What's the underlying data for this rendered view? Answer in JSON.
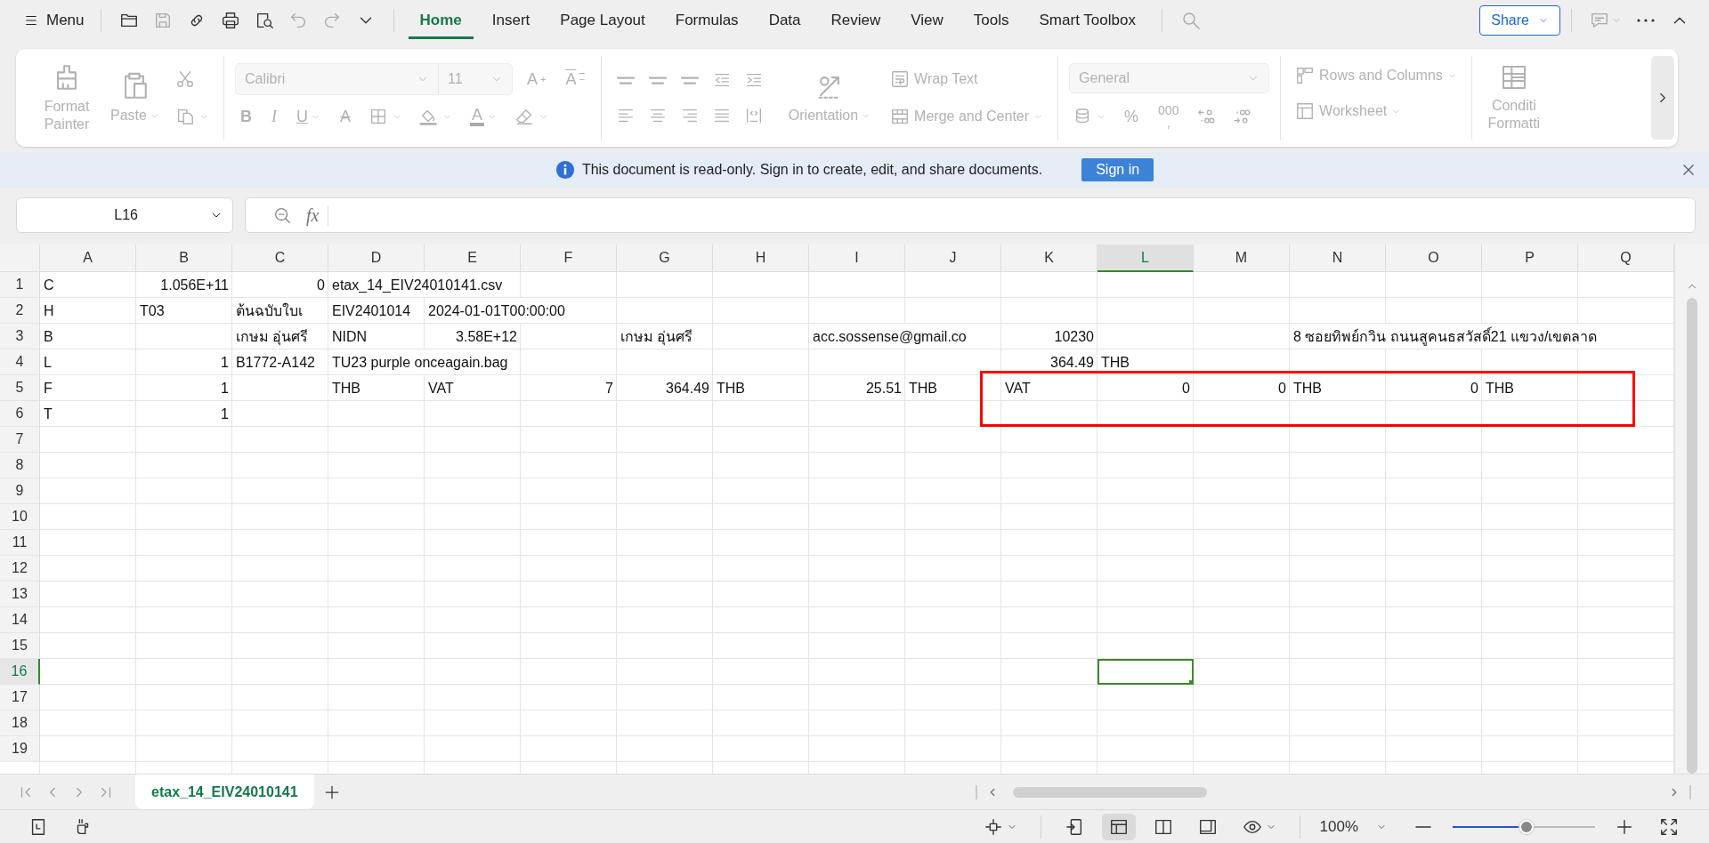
{
  "menu_bar": {
    "menu_label": "Menu",
    "tabs": [
      {
        "label": "Home",
        "selected": true
      },
      {
        "label": "Insert",
        "selected": false
      },
      {
        "label": "Page Layout",
        "selected": false
      },
      {
        "label": "Formulas",
        "selected": false
      },
      {
        "label": "Data",
        "selected": false
      },
      {
        "label": "Review",
        "selected": false
      },
      {
        "label": "View",
        "selected": false
      },
      {
        "label": "Tools",
        "selected": false
      },
      {
        "label": "Smart Toolbox",
        "selected": false
      }
    ],
    "share_label": "Share"
  },
  "ribbon": {
    "disabled": true,
    "format_painter": "Format Painter",
    "paste": "Paste",
    "font_name": "Calibri",
    "font_size": "11",
    "grow_font": "A$^{+}$",
    "shrink_font": "A$^{−}$",
    "font_styles": [
      {
        "kind": "bold",
        "label": "B"
      },
      {
        "kind": "italic",
        "label": "I"
      },
      {
        "kind": "underline",
        "label": "U"
      },
      {
        "kind": "strikethrough",
        "label": "A"
      }
    ],
    "font_color": "A",
    "orientation": "Orientation",
    "wrap_text": "Wrap Text",
    "merge_and_center": "Merge and Center",
    "number_format": "General",
    "percent": "%",
    "thousands": "000\n,",
    "rows_and_columns": "Rows and Columns",
    "worksheet": "Worksheet",
    "conditional_formatting": "Conditi Formatti"
  },
  "notice": {
    "message": "This document is read-only. Sign in to create, edit, and share documents.",
    "button": "Sign in"
  },
  "formula_bar": {
    "cell_reference": "L16",
    "function_label": "fx"
  },
  "sheet": {
    "columns": [
      {
        "label": "A",
        "selected": false
      },
      {
        "label": "B",
        "selected": false
      },
      {
        "label": "C",
        "selected": false
      },
      {
        "label": "D",
        "selected": false
      },
      {
        "label": "E",
        "selected": false
      },
      {
        "label": "F",
        "selected": false
      },
      {
        "label": "G",
        "selected": false
      },
      {
        "label": "H",
        "selected": false
      },
      {
        "label": "I",
        "selected": false
      },
      {
        "label": "J",
        "selected": false
      },
      {
        "label": "K",
        "selected": false
      },
      {
        "label": "L",
        "selected": true
      },
      {
        "label": "M",
        "selected": false
      },
      {
        "label": "N",
        "selected": false
      },
      {
        "label": "O",
        "selected": false
      },
      {
        "label": "P",
        "selected": false
      },
      {
        "label": "Q",
        "selected": false
      }
    ],
    "rows": [
      {
        "label": "1",
        "selected": false,
        "cells": [
          {
            "kind": "text",
            "text": "C"
          },
          {
            "kind": "number",
            "text": "1.056E+11"
          },
          {
            "kind": "number",
            "text": "0"
          },
          {
            "kind": "text",
            "text": "etax_14_EIV24010141.csv"
          }
        ]
      },
      {
        "label": "2",
        "selected": false,
        "cells": [
          {
            "kind": "text",
            "text": "H"
          },
          {
            "kind": "text",
            "text": "T03"
          },
          {
            "kind": "text",
            "text": "ต้นฉบับใบเ"
          },
          {
            "kind": "text",
            "text": "EIV2401014"
          },
          {
            "kind": "text",
            "text": "2024-01-01T00:00:00"
          }
        ]
      },
      {
        "label": "3",
        "selected": false,
        "cells": [
          {
            "kind": "text",
            "text": "B"
          },
          {
            "kind": "empty"
          },
          {
            "kind": "text",
            "text": "เกษม อุ่นศรี"
          },
          {
            "kind": "text",
            "text": "NIDN"
          },
          {
            "kind": "number",
            "text": "3.58E+12"
          },
          {
            "kind": "empty"
          },
          {
            "kind": "text",
            "text": "เกษม อุ่นศรี"
          },
          {
            "kind": "empty"
          },
          {
            "kind": "text",
            "text": "acc.sossense@gmail.co"
          },
          {
            "kind": "empty"
          },
          {
            "kind": "number",
            "text": "10230"
          },
          {
            "kind": "empty"
          },
          {
            "kind": "empty"
          },
          {
            "kind": "text",
            "text": "8 ซอยทิพย์กวิน ถนนสูคนธสวัสดิ์21 แขวง/เขตลาด"
          }
        ]
      },
      {
        "label": "4",
        "selected": false,
        "cells": [
          {
            "kind": "text",
            "text": "L"
          },
          {
            "kind": "number",
            "text": "1"
          },
          {
            "kind": "text",
            "text": "B1772-A142"
          },
          {
            "kind": "text",
            "text": "TU23 purple onceagain.bag"
          },
          {
            "kind": "empty"
          },
          {
            "kind": "empty"
          },
          {
            "kind": "empty"
          },
          {
            "kind": "empty"
          },
          {
            "kind": "empty"
          },
          {
            "kind": "empty"
          },
          {
            "kind": "number",
            "text": "364.49"
          },
          {
            "kind": "text",
            "text": "THB"
          }
        ]
      },
      {
        "label": "5",
        "selected": false,
        "cells": [
          {
            "kind": "text",
            "text": "F"
          },
          {
            "kind": "number",
            "text": "1"
          },
          {
            "kind": "empty"
          },
          {
            "kind": "text",
            "text": "THB"
          },
          {
            "kind": "text",
            "text": "VAT"
          },
          {
            "kind": "number",
            "text": "7"
          },
          {
            "kind": "number",
            "text": "364.49"
          },
          {
            "kind": "text",
            "text": "THB"
          },
          {
            "kind": "number",
            "text": "25.51"
          },
          {
            "kind": "text",
            "text": "THB"
          },
          {
            "kind": "text",
            "text": "VAT"
          },
          {
            "kind": "number",
            "text": "0"
          },
          {
            "kind": "number",
            "text": "0"
          },
          {
            "kind": "text",
            "text": "THB"
          },
          {
            "kind": "number",
            "text": "0"
          },
          {
            "kind": "text",
            "text": "THB"
          }
        ]
      },
      {
        "label": "6",
        "selected": false,
        "cells": [
          {
            "kind": "text",
            "text": "T"
          },
          {
            "kind": "number",
            "text": "1"
          }
        ]
      },
      {
        "label": "7",
        "selected": false
      },
      {
        "label": "8",
        "selected": false
      },
      {
        "label": "9",
        "selected": false
      },
      {
        "label": "10",
        "selected": false
      },
      {
        "label": "11",
        "selected": false
      },
      {
        "label": "12",
        "selected": false
      },
      {
        "label": "13",
        "selected": false
      },
      {
        "label": "14",
        "selected": false
      },
      {
        "label": "15",
        "selected": false
      },
      {
        "label": "16",
        "selected": true
      },
      {
        "label": "17",
        "selected": false
      },
      {
        "label": "18",
        "selected": false
      },
      {
        "label": "19",
        "selected": false
      }
    ],
    "annotation": {
      "kind": "rectangle"
    }
  },
  "sheet_tabs": [
    {
      "label": "etax_14_EIV24010141",
      "selected": true
    }
  ],
  "status_bar": {
    "zoom": "100%",
    "zoom_slider": {
      "level": 0.52
    }
  }
}
